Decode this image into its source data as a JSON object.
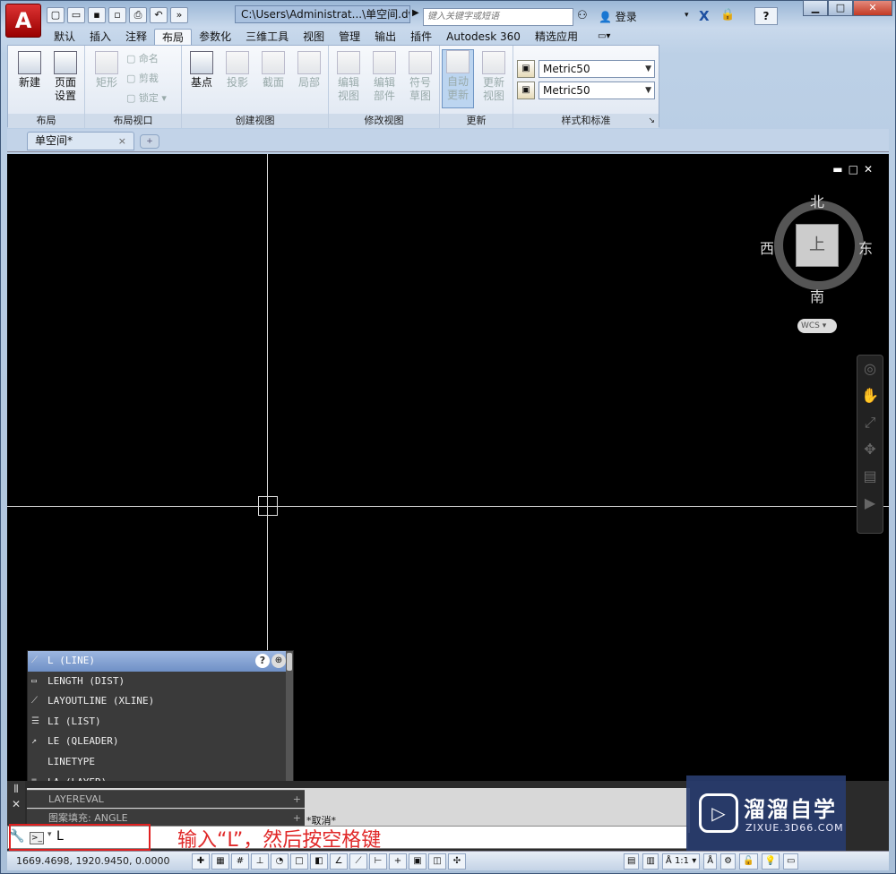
{
  "window": {
    "app_letter": "A",
    "title_path": "C:\\Users\\Administrat...\\单空间.dwg",
    "search_placeholder": "键入关键字或短语",
    "login": "登录",
    "help": "?",
    "min": "▁",
    "max": "□",
    "close": "✕"
  },
  "ribbon_tabs": [
    "默认",
    "插入",
    "注释",
    "布局",
    "参数化",
    "三维工具",
    "视图",
    "管理",
    "输出",
    "插件",
    "Autodesk 360",
    "精选应用"
  ],
  "active_tab": "布局",
  "ribbon": {
    "layout": {
      "label": "布局",
      "new": "新建",
      "page_setup_1": "页面",
      "page_setup_2": "设置"
    },
    "layout_viewport": {
      "label": "布局视口",
      "rect": "矩形",
      "name": "命名",
      "clip": "剪裁",
      "lock": "锁定"
    },
    "create_view": {
      "label": "创建视图",
      "base": "基点",
      "projected": "投影",
      "section": "截面",
      "detail": "局部"
    },
    "modify_view": {
      "label": "修改视图",
      "edit_view_1": "编辑",
      "edit_view_2": "视图",
      "edit_comp_1": "编辑",
      "edit_comp_2": "部件",
      "symbol_1": "符号",
      "symbol_2": "草图"
    },
    "update": {
      "label": "更新",
      "auto_1": "自动",
      "auto_2": "更新",
      "update_view_1": "更新",
      "update_view_2": "视图"
    },
    "styles": {
      "label": "样式和标准",
      "style1": "Metric50",
      "style2": "Metric50"
    }
  },
  "file_tab": {
    "name": "单空间*",
    "close": "×"
  },
  "viewcube": {
    "north": "北",
    "south": "南",
    "east": "东",
    "west": "西",
    "face": "上",
    "wcs": "WCS"
  },
  "autocomplete": {
    "items": [
      {
        "text": "L (LINE)",
        "icon": "line-icon"
      },
      {
        "text": "LENGTH (DIST)",
        "icon": "ruler-icon"
      },
      {
        "text": "LAYOUTLINE (XLINE)",
        "icon": "xline-icon"
      },
      {
        "text": "LI (LIST)",
        "icon": "list-icon"
      },
      {
        "text": "LE (QLEADER)",
        "icon": "leader-icon"
      },
      {
        "text": "LINETYPE",
        "icon": ""
      },
      {
        "text": "LA (LAYER)",
        "icon": "layer-icon"
      }
    ],
    "selected_index": 0,
    "layereval": "LAYEREVAL",
    "hatch": "图案填充: ANGLE"
  },
  "command": {
    "cancel_text": "*取消*",
    "typed": "L",
    "hint": "输入“L”，然后按空格键"
  },
  "status": {
    "coords": "1669.4698, 1920.9450, 0.0000",
    "scale": "1:1"
  },
  "watermark": {
    "title": "溜溜自学",
    "sub": "ZIXUE.3D66.COM"
  }
}
